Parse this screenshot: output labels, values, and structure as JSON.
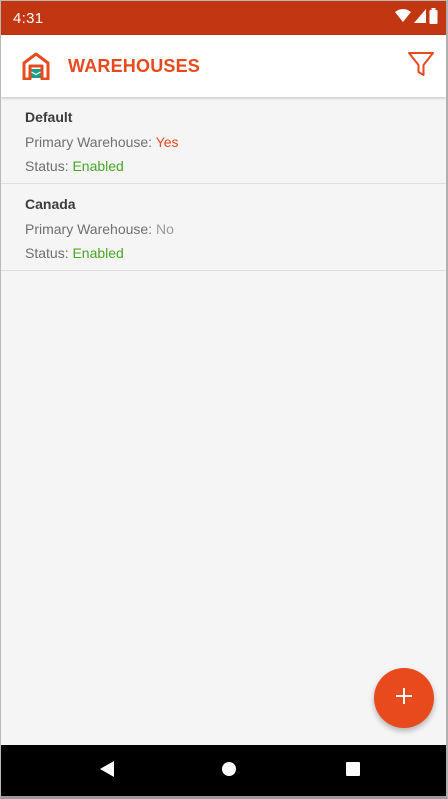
{
  "status_bar": {
    "time": "4:31",
    "icons": [
      "wifi-icon",
      "signal-icon",
      "battery-icon"
    ]
  },
  "app_bar": {
    "title": "WAREHOUSES",
    "logo_icon": "warehouse-logo-icon",
    "filter_icon": "filter-icon"
  },
  "warehouses": [
    {
      "name": "Default",
      "primary_label": "Primary Warehouse: ",
      "primary_value": "Yes",
      "status_label": "Status: ",
      "status_value": "Enabled"
    },
    {
      "name": "Canada",
      "primary_label": "Primary Warehouse: ",
      "primary_value": "No",
      "status_label": "Status: ",
      "status_value": "Enabled"
    }
  ],
  "fab": {
    "icon": "plus-icon"
  },
  "nav_bar": {
    "icons": [
      "back-icon",
      "home-icon",
      "recents-icon"
    ]
  },
  "colors": {
    "status_bar": "#c23611",
    "accent": "#e8491d",
    "enabled": "#49a625",
    "no_value": "#9a9a9a",
    "logo_teal": "#1e9c84"
  }
}
